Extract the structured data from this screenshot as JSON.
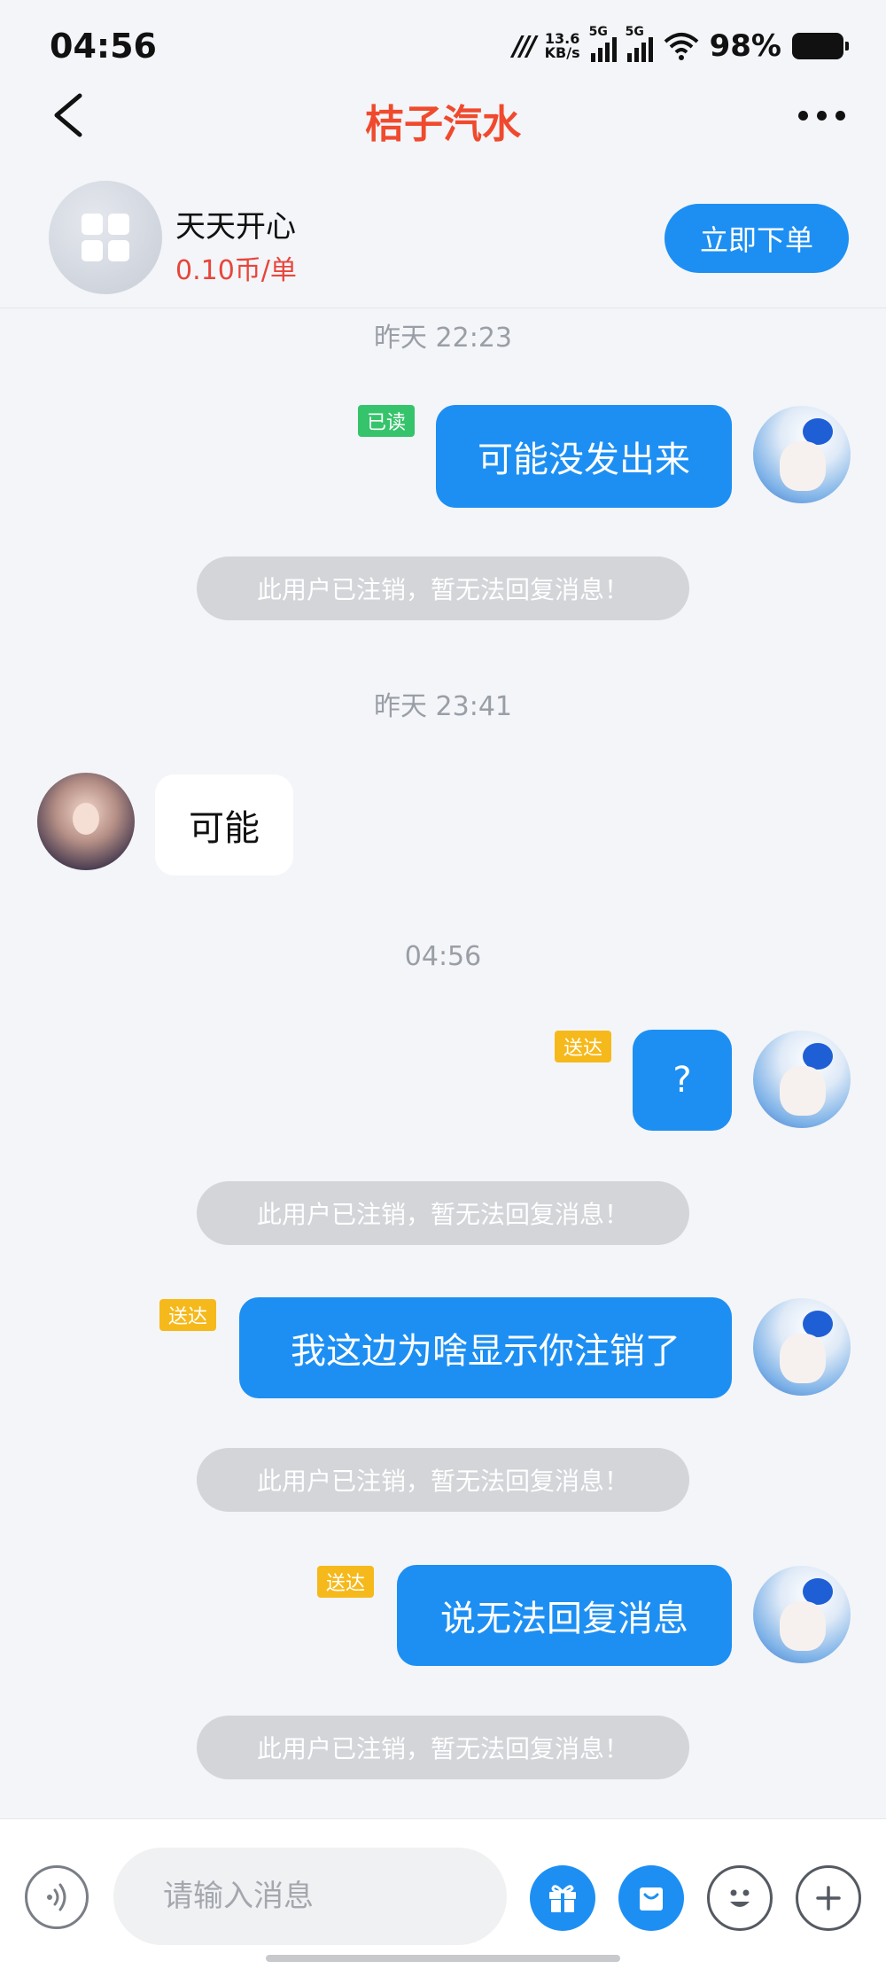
{
  "status_bar": {
    "time": "04:56",
    "net_speed_value": "13.6",
    "net_speed_unit": "KB/s",
    "signal_1_label": "5G",
    "signal_2_label": "5G",
    "battery_percent": "98%"
  },
  "header": {
    "title": "桔子汽水"
  },
  "service": {
    "name": "天天开心",
    "price": "0.10币/单",
    "order_button": "立即下单"
  },
  "messages": {
    "ts1": "昨天 22:23",
    "m1_text": "可能没发出来",
    "m1_status": "已读",
    "sys1": "此用户已注销，暂无法回复消息！",
    "ts2": "昨天 23:41",
    "m2_text": "可能",
    "ts3": "04:56",
    "m3_text": "?",
    "m3_status": "送达",
    "sys2": "此用户已注销，暂无法回复消息！",
    "m4_text": "我这边为啥显示你注销了",
    "m4_status": "送达",
    "sys3": "此用户已注销，暂无法回复消息！",
    "m5_text": "说无法回复消息",
    "m5_status": "送达",
    "sys4": "此用户已注销，暂无法回复消息！"
  },
  "input": {
    "placeholder": "请输入消息"
  },
  "colors": {
    "accent_blue": "#1d8ff3",
    "title_red": "#f04a2e",
    "price_red": "#e8453c",
    "read_green": "#35c46b",
    "sent_yellow": "#f6b91b"
  },
  "icons": {
    "back": "chevron-left-icon",
    "more": "more-dots-icon",
    "voice": "voice-icon",
    "gift": "gift-icon",
    "order": "order-bag-icon",
    "emoji": "emoji-icon",
    "plus": "plus-icon"
  }
}
